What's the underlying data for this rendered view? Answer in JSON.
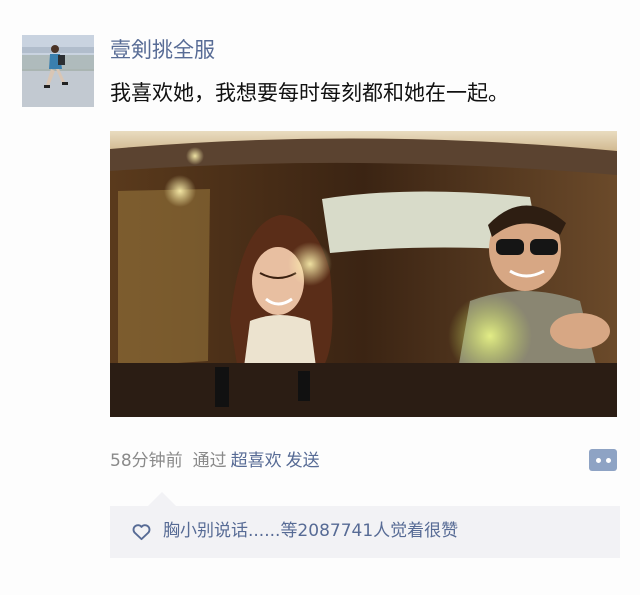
{
  "post": {
    "username": "壹剣挑全服",
    "text": "我喜欢她，我想要每时每刻都和她在一起。",
    "avatar_icon": "person-walking-avatar",
    "photo_icon": "couple-in-car-photo"
  },
  "meta": {
    "time": "58分钟前",
    "via": "通过",
    "app": "超喜欢",
    "send": "发送",
    "comment_icon": "comment-dots-icon"
  },
  "likes": {
    "icon": "heart-outline-icon",
    "names": "胸小别说话......",
    "rest": "等2087741人觉着很赞"
  },
  "colors": {
    "link": "#576b95",
    "meta_gray": "#8a8a8a",
    "likes_bg": "#f2f2f5",
    "comment_button": "#8ea3c4"
  }
}
